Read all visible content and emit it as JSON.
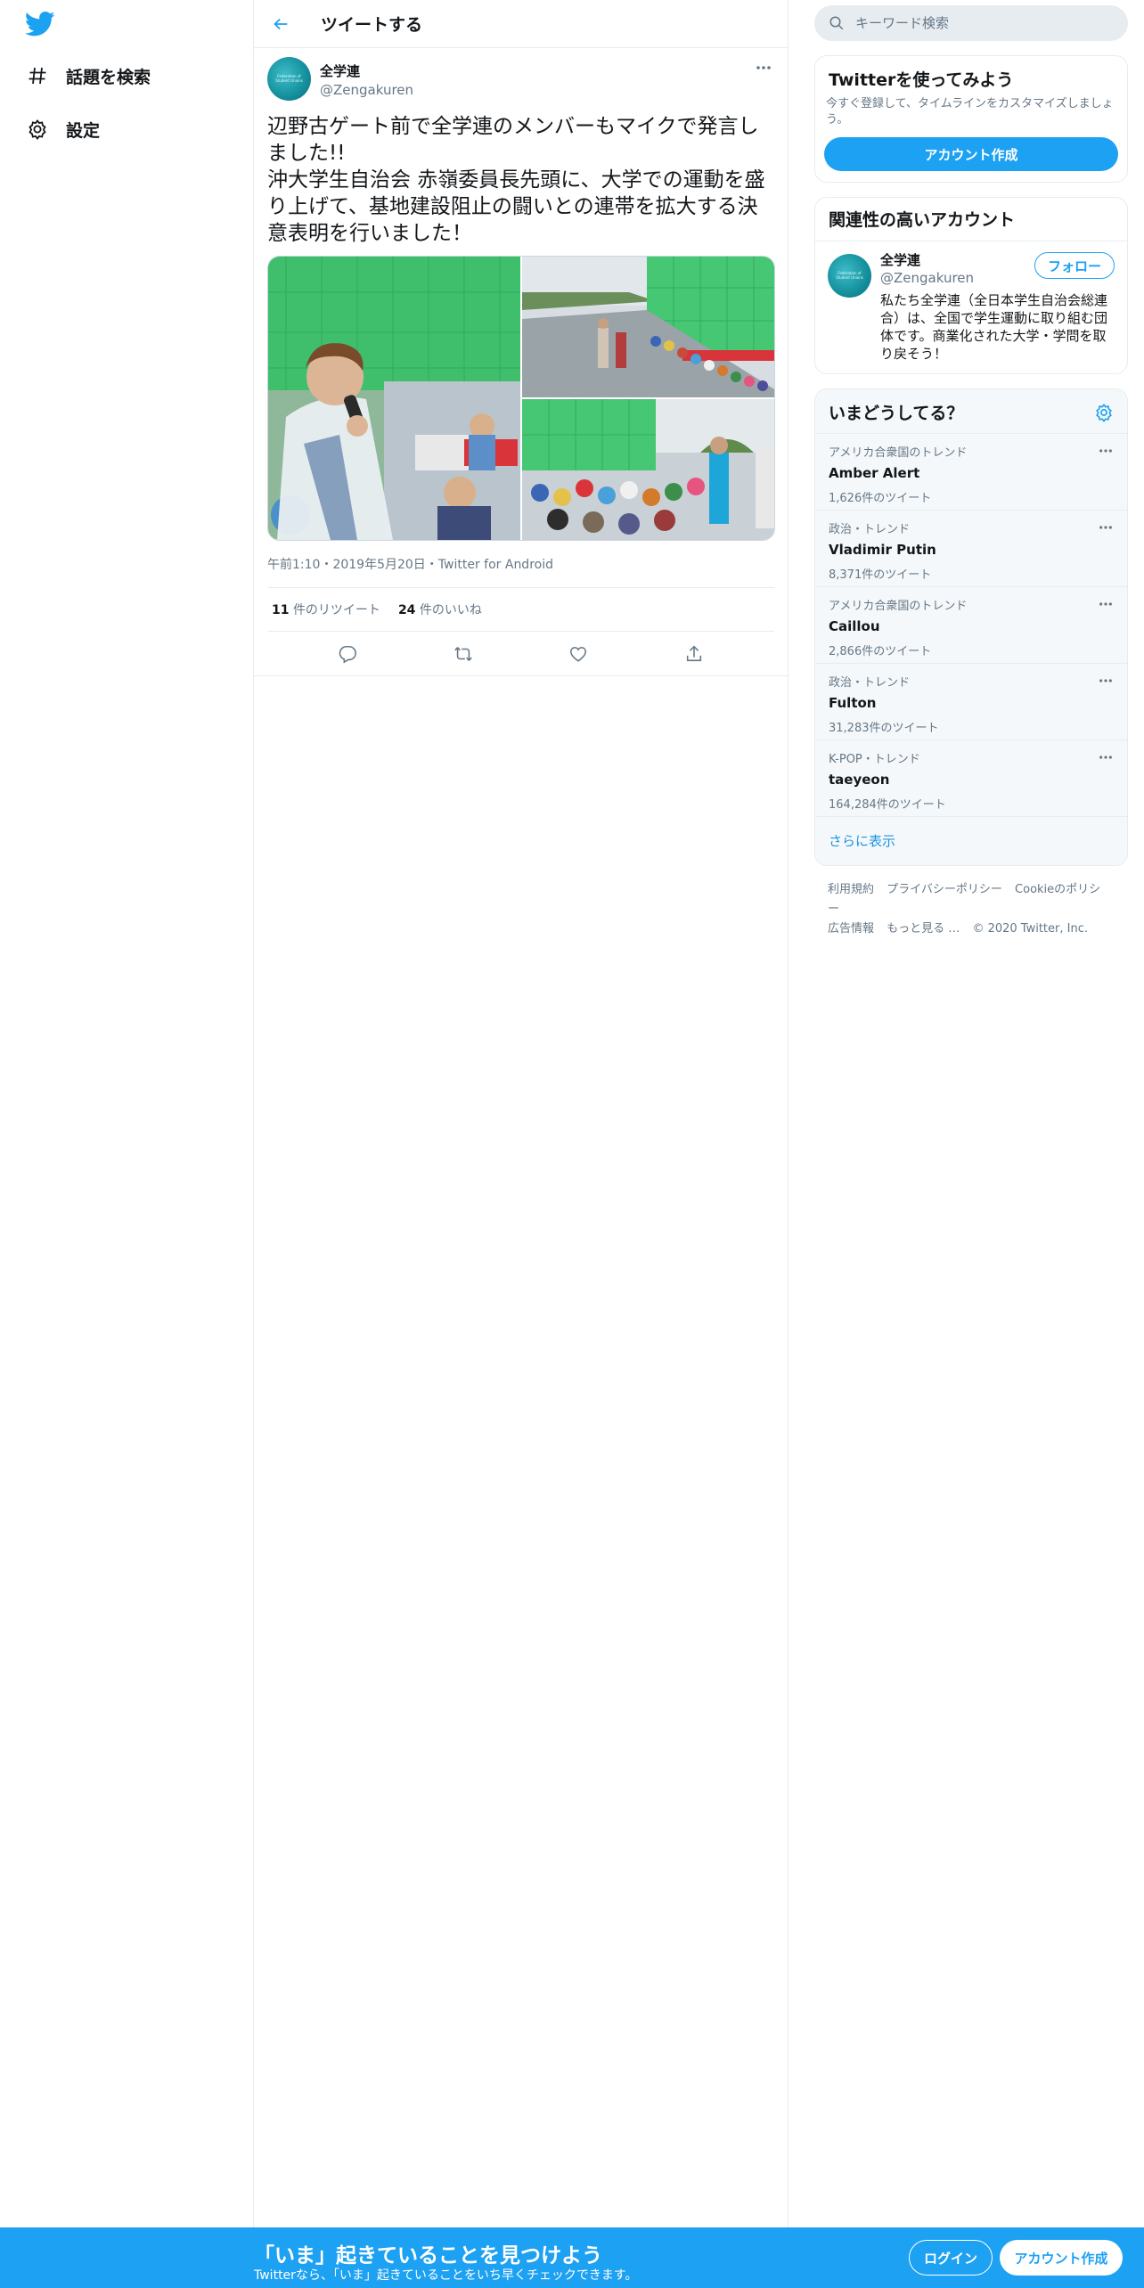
{
  "colors": {
    "accent": "#1da1f2",
    "text": "#14171a",
    "secondary": "#657786",
    "border": "#e6ecf0"
  },
  "nav": {
    "items": [
      {
        "label": "話題を検索",
        "icon": "hashtag-icon"
      },
      {
        "label": "設定",
        "icon": "gear-icon"
      }
    ]
  },
  "header": {
    "title": "ツイートする"
  },
  "tweet": {
    "author": {
      "name": "全学連",
      "handle": "@Zengakuren",
      "avatar_text": "Federation of Student Unions"
    },
    "text": "辺野古ゲート前で全学連のメンバーもマイクで発言しました!!\n沖大学生自治会 赤嶺委員長先頭に、大学での運動を盛り上げて、基地建設阻止の闘いとの連帯を拡大する決意表明を行いました！",
    "meta": "午前1:10・2019年5月20日・Twitter for Android",
    "retweets": {
      "count": "11",
      "label": "件のリツイート"
    },
    "likes": {
      "count": "24",
      "label": "件のいいね"
    }
  },
  "search": {
    "placeholder": "キーワード検索"
  },
  "signup_card": {
    "title": "Twitterを使ってみよう",
    "subtitle": "今すぐ登録して、タイムラインをカスタマイズしましょう。",
    "button": "アカウント作成"
  },
  "related": {
    "title": "関連性の高いアカウント",
    "user": {
      "name": "全学連",
      "handle": "@Zengakuren",
      "bio": "私たち全学連（全日本学生自治会総連合）は、全国で学生運動に取り組む団体です。商業化された大学・学問を取り戻そう！",
      "follow": "フォロー"
    }
  },
  "trends": {
    "title": "いまどうしてる？",
    "items": [
      {
        "category": "アメリカ合衆国のトレンド",
        "name": "Amber Alert",
        "count": "1,626件のツイート"
      },
      {
        "category": "政治・トレンド",
        "name": "Vladimir Putin",
        "count": "8,371件のツイート"
      },
      {
        "category": "アメリカ合衆国のトレンド",
        "name": "Caillou",
        "count": "2,866件のツイート"
      },
      {
        "category": "政治・トレンド",
        "name": "Fulton",
        "count": "31,283件のツイート"
      },
      {
        "category": "K-POP・トレンド",
        "name": "taeyeon",
        "count": "164,284件のツイート"
      }
    ],
    "show_more": "さらに表示"
  },
  "footer": {
    "links": [
      "利用規約",
      "プライバシーポリシー",
      "Cookieのポリシー",
      "広告情報",
      "もっと見る …"
    ],
    "copyright": "© 2020 Twitter, Inc."
  },
  "bottom_bar": {
    "title": "「いま」起きていることを見つけよう",
    "subtitle": "Twitterなら、「いま」起きていることをいち早くチェックできます。",
    "login": "ログイン",
    "signup": "アカウント作成"
  }
}
